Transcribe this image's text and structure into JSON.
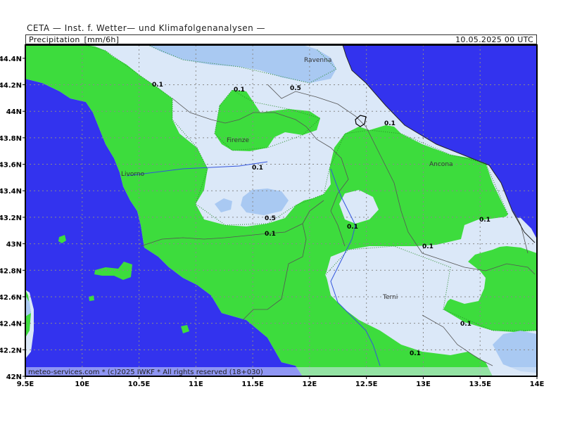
{
  "header": {
    "title": "CETA — Inst. f. Wetter— und Klimafolgenanalysen —",
    "variable": "Precipitation_[mm/6h]",
    "valid_time": "10.05.2025 00 UTC"
  },
  "map": {
    "lon_range": [
      9.5,
      14.0
    ],
    "lat_range": [
      42.0,
      44.5
    ],
    "lat_ticks": [
      "44.4N",
      "44.2N",
      "44N",
      "43.8N",
      "43.6N",
      "43.4N",
      "43.2N",
      "43N",
      "42.8N",
      "42.6N",
      "42.4N",
      "42.2N",
      "42N"
    ],
    "lon_ticks": [
      "9.5E",
      "10E",
      "10.5E",
      "11E",
      "11.5E",
      "12E",
      "12.5E",
      "13E",
      "13.5E",
      "14E"
    ],
    "cities": [
      {
        "name": "Ravenna"
      },
      {
        "name": "Firenze"
      },
      {
        "name": "Livorno"
      },
      {
        "name": "Ancona"
      },
      {
        "name": "Terni"
      }
    ],
    "contour_labels": [
      "0.1",
      "0.1",
      "0.5",
      "0.1",
      "0.1",
      "0.5",
      "0.1",
      "0.1",
      "0.1",
      "0.1",
      "0.1",
      "0.1"
    ],
    "colors": {
      "sea": "#3333ee",
      "dry_land": "#dbe8f8",
      "precip_0_1": "#3ddc3d",
      "precip_0_5": "#a9c9f2",
      "grid": "#8a8a8a",
      "border": "#555555",
      "river": "#3355dd"
    }
  },
  "footer": {
    "credit": "meteo-services.com * (c)2025 IWKF * All rights reserved (18+030)"
  }
}
